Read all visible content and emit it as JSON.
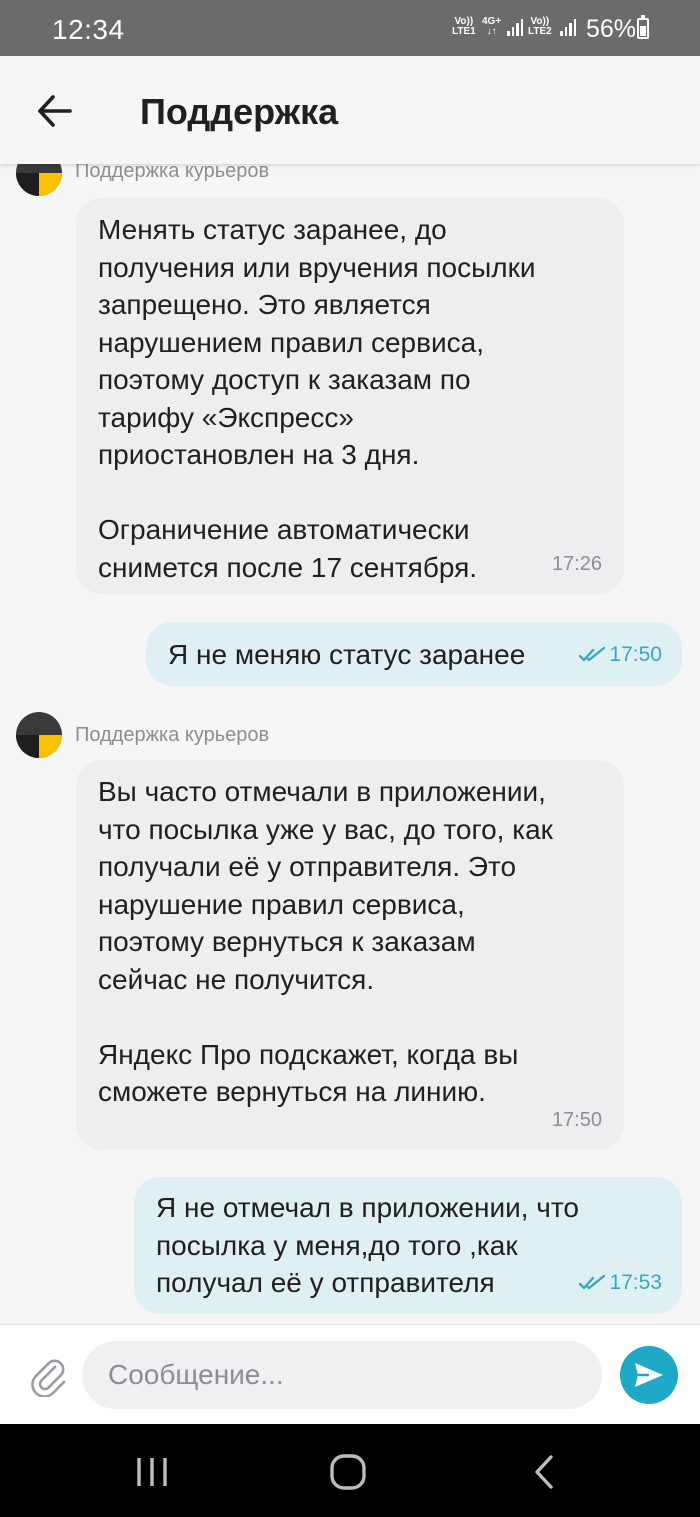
{
  "status_bar": {
    "time": "12:34",
    "sim1_top": "Vo))",
    "sim1_bottom": "LTE1",
    "net_top": "4G+",
    "net_bottom": "↓↑",
    "sim2_top": "Vo))",
    "sim2_bottom": "LTE2",
    "battery_text": "56%",
    "battery_level": 0.56
  },
  "header": {
    "title": "Поддержка"
  },
  "messages": [
    {
      "direction": "in",
      "sender": "Поддержка курьеров",
      "text": "Менять статус заранее, до\nполучения или вручения посылки\nзапрещено. Это является\nнарушением правил сервиса,\nпоэтому доступ к заказам по\nтарифу «Экспресс»\nприостановлен на 3 дня.\n\nОграничение автоматически\nснимется после 17 сентября.",
      "time": "17:26"
    },
    {
      "direction": "out",
      "text": "Я не меняю статус заранее",
      "time": "17:50"
    },
    {
      "direction": "in",
      "sender": "Поддержка курьеров",
      "text": "Вы часто отмечали в приложении,\nчто посылка уже у вас, до того, как\nполучали её у отправителя. Это\nнарушение правил сервиса,\nпоэтому вернуться к заказам\nсейчас не получится.\n\nЯндекс Про подскажет, когда вы\nсможете вернуться на линию.",
      "time": "17:50"
    },
    {
      "direction": "out",
      "text": "Я не отмечал в приложении, что\nпосылка у меня,до того ,как\nполучал её у отправителя",
      "time": "17:53"
    }
  ],
  "composer": {
    "placeholder": "Сообщение..."
  },
  "colors": {
    "accent": "#1fa8c8",
    "incoming_bubble": "#eeeef1",
    "outgoing_bubble": "#dff0f4",
    "avatar_yellow": "#fcc200",
    "avatar_dark": "#3a3a38"
  }
}
